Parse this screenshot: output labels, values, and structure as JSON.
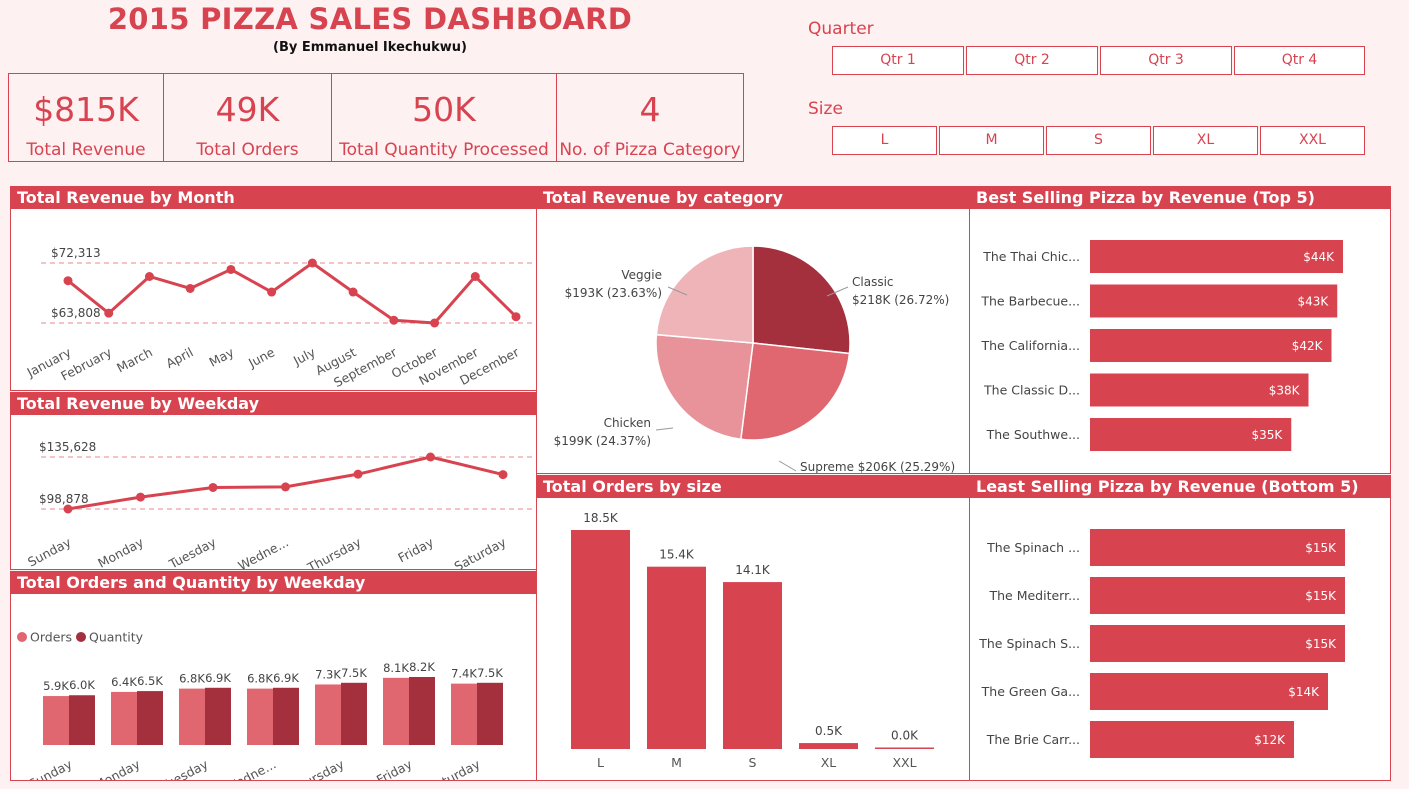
{
  "header": {
    "title": "2015 PIZZA SALES DASHBOARD",
    "subtitle": "(By Emmanuel Ikechukwu)"
  },
  "kpis": [
    {
      "value": "$815K",
      "label": "Total Revenue"
    },
    {
      "value": "49K",
      "label": "Total Orders"
    },
    {
      "value": "50K",
      "label": "Total Quantity Processed"
    },
    {
      "value": "4",
      "label": "No. of Pizza Category"
    }
  ],
  "slicers": {
    "quarter": {
      "title": "Quarter",
      "options": [
        "Qtr 1",
        "Qtr 2",
        "Qtr 3",
        "Qtr 4"
      ]
    },
    "size": {
      "title": "Size",
      "options": [
        "L",
        "M",
        "S",
        "XL",
        "XXL"
      ]
    }
  },
  "colors": {
    "accent": "#d84350",
    "dark": "#a3303c",
    "mid": "#e06670",
    "light": "#e8929a",
    "pale": "#efb4b8",
    "bg": "#fdf1f2"
  },
  "chart_data": [
    {
      "id": "revenue_by_month",
      "type": "line",
      "title": "Total Revenue by Month",
      "categories": [
        "January",
        "February",
        "March",
        "April",
        "May",
        "June",
        "July",
        "August",
        "September",
        "October",
        "November",
        "December"
      ],
      "values": [
        69800,
        65200,
        70400,
        68700,
        71400,
        68200,
        72313,
        68200,
        64200,
        63808,
        70400,
        64700
      ],
      "reference_labels": [
        "$72,313",
        "$63,808"
      ],
      "ylim": [
        63808,
        72313
      ]
    },
    {
      "id": "revenue_by_weekday",
      "type": "line",
      "title": "Total Revenue by Weekday",
      "categories": [
        "Sunday",
        "Monday",
        "Tuesday",
        "Wedne...",
        "Thursday",
        "Friday",
        "Saturday"
      ],
      "values": [
        98878,
        107300,
        114100,
        114500,
        123500,
        135628,
        123200
      ],
      "reference_labels": [
        "$135,628",
        "$98,878"
      ],
      "ylim": [
        98878,
        135628
      ]
    },
    {
      "id": "orders_quantity_by_weekday",
      "type": "bar",
      "title": "Total Orders and Quantity by Weekday",
      "categories": [
        "Sunday",
        "Monday",
        "Tuesday",
        "Wedne...",
        "Thursday",
        "Friday",
        "Saturday"
      ],
      "series": [
        {
          "name": "Orders",
          "values": [
            5.9,
            6.4,
            6.8,
            6.8,
            7.3,
            8.1,
            7.4
          ],
          "labels": [
            "5.9K",
            "6.4K",
            "6.8K",
            "6.8K",
            "7.3K",
            "8.1K",
            "7.4K"
          ]
        },
        {
          "name": "Quantity",
          "values": [
            6.0,
            6.5,
            6.9,
            6.9,
            7.5,
            8.2,
            7.5
          ],
          "labels": [
            "6.0K",
            "6.5K",
            "6.9K",
            "6.9K",
            "7.5K",
            "8.2K",
            "7.5K"
          ]
        }
      ],
      "ylim": [
        0,
        12
      ],
      "legend": "top-left"
    },
    {
      "id": "revenue_by_category",
      "type": "pie",
      "title": "Total Revenue by category",
      "slices": [
        {
          "name": "Classic",
          "value": 26.72,
          "label": "$218K (26.72%)"
        },
        {
          "name": "Supreme",
          "value": 25.29,
          "label": "$206K (25.29%)"
        },
        {
          "name": "Chicken",
          "value": 24.37,
          "label": "$199K (24.37%)"
        },
        {
          "name": "Veggie",
          "value": 23.63,
          "label": "$193K (23.63%)"
        }
      ]
    },
    {
      "id": "orders_by_size",
      "type": "bar",
      "title": "Total Orders by size",
      "categories": [
        "L",
        "M",
        "S",
        "XL",
        "XXL"
      ],
      "values": [
        18.5,
        15.4,
        14.1,
        0.5,
        0.0
      ],
      "labels": [
        "18.5K",
        "15.4K",
        "14.1K",
        "0.5K",
        "0.0K"
      ],
      "ylim": [
        0,
        18.5
      ]
    },
    {
      "id": "best_selling",
      "type": "bar",
      "orientation": "horizontal",
      "title": "Best Selling Pizza by Revenue (Top 5)",
      "categories": [
        "The Thai Chic...",
        "The Barbecue...",
        "The California...",
        "The Classic D...",
        "The Southwe..."
      ],
      "values": [
        44,
        43,
        42,
        38,
        35
      ],
      "labels": [
        "$44K",
        "$43K",
        "$42K",
        "$38K",
        "$35K"
      ],
      "xlim": [
        0,
        44
      ]
    },
    {
      "id": "least_selling",
      "type": "bar",
      "orientation": "horizontal",
      "title": "Least Selling Pizza by Revenue (Bottom 5)",
      "categories": [
        "The Spinach ...",
        "The Mediterr...",
        "The Spinach S...",
        "The Green Ga...",
        "The Brie Carr..."
      ],
      "values": [
        15,
        15,
        15,
        14,
        12
      ],
      "labels": [
        "$15K",
        "$15K",
        "$15K",
        "$14K",
        "$12K"
      ],
      "xlim": [
        0,
        15
      ]
    }
  ]
}
